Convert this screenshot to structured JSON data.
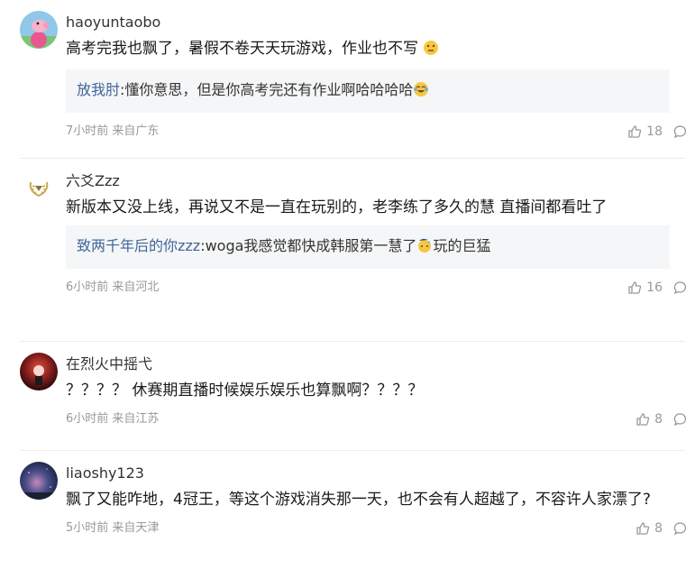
{
  "comments": [
    {
      "username": "haoyuntaobo",
      "avatar": "peppa-pig-avatar",
      "text": "高考完我也飘了，暑假不卷天天玩游戏，作业也不写",
      "text_emoji": "thinking-face-emoji",
      "reply": {
        "name": "放我肘",
        "text": ":懂你意思，但是你高考完还有作业啊哈哈哈哈",
        "emoji": "laughing-tears-emoji"
      },
      "time": "7小时前 来自广东",
      "likes": "18"
    },
    {
      "username": "六爻Zzz",
      "avatar": "laurel-badge-avatar",
      "text": "新版本又没上线，再说又不是一直在玩别的，老李练了多久的慧 直播间都看吐了",
      "reply": {
        "name": "致两千年后的你zzz",
        "text": ":woga我感觉都快成韩服第一慧了",
        "emoji": "sweat-emoji",
        "text_after": "玩的巨猛"
      },
      "time": "6小时前 来自河北",
      "likes": "16"
    },
    {
      "username": "在烈火中摇弋",
      "avatar": "red-glow-avatar",
      "text": "？？？？ 休赛期直播时候娱乐娱乐也算飘啊？？？？",
      "time": "6小时前 来自江苏",
      "likes": "8"
    },
    {
      "username": "liaoshy123",
      "avatar": "nebula-avatar",
      "text": "飘了又能咋地，4冠王，等这个游戏消失那一天，也不会有人超越了，不容许人家漂了?",
      "time": "5小时前 来自天津",
      "likes": "8"
    }
  ]
}
